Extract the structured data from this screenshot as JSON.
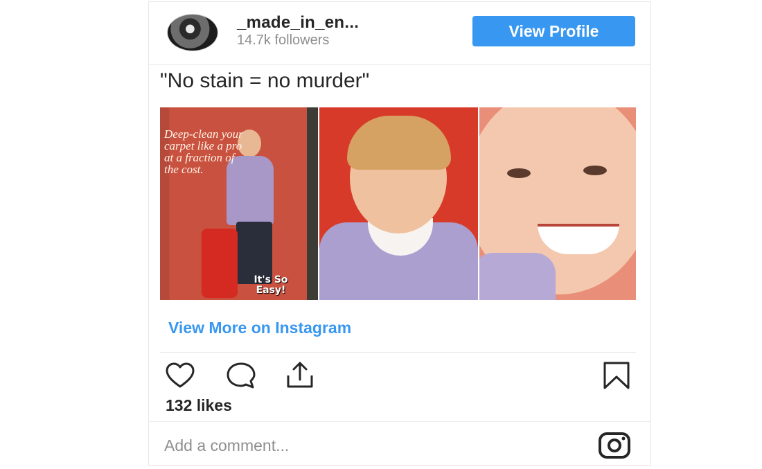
{
  "profile": {
    "username": "_made_in_en...",
    "followers": "14.7k followers",
    "view_profile_label": "View Profile"
  },
  "post": {
    "caption": "\"No stain = no murder\"",
    "ad_text": "Deep-clean your carpet like a pro at a fraction of the cost.",
    "ad_slogan": "It's So Easy!",
    "view_more_label": "View More on Instagram",
    "likes": "132 likes"
  },
  "comment": {
    "placeholder": "Add a comment..."
  },
  "icons": {
    "like": "heart-icon",
    "comment": "comment-bubble-icon",
    "share": "share-upload-icon",
    "save": "bookmark-icon",
    "brand": "instagram-logo-icon"
  },
  "colors": {
    "accent": "#3897f0",
    "text": "#262626",
    "muted": "#8e8e8e"
  }
}
